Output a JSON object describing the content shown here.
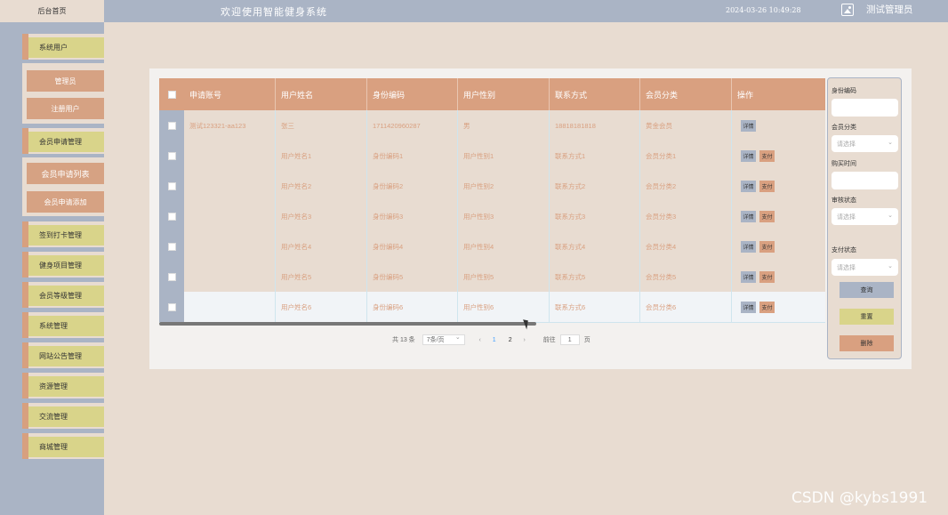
{
  "header": {
    "home_tab": "后台首页",
    "app_title": "欢迎使用智能健身系统",
    "datetime": "2024-03-26 10:49:28",
    "user_name": "测试管理员"
  },
  "sidebar": {
    "menu": [
      {
        "label": "系统用户"
      },
      {
        "label": "会员申请管理"
      },
      {
        "label": "签到打卡管理"
      },
      {
        "label": "健身项目管理"
      },
      {
        "label": "会员等级管理"
      },
      {
        "label": "系统管理"
      },
      {
        "label": "网站公告管理"
      },
      {
        "label": "资源管理"
      },
      {
        "label": "交流管理"
      },
      {
        "label": "商城管理"
      }
    ],
    "submenu_users": [
      {
        "label": "管理员"
      },
      {
        "label": "注册用户"
      }
    ],
    "submenu_apply": [
      {
        "label": "会员申请列表"
      },
      {
        "label": "会员申请添加"
      }
    ]
  },
  "table": {
    "headers": [
      "申请账号",
      "用户姓名",
      "身份编码",
      "用户性别",
      "联系方式",
      "会员分类",
      "操作"
    ],
    "rows": [
      [
        "测试123321-aa123",
        "张三",
        "1711420960287",
        "男",
        "18818181818",
        "黄金会员"
      ],
      [
        "",
        "用户姓名1",
        "身份编码1",
        "用户性别1",
        "联系方式1",
        "会员分类1"
      ],
      [
        "",
        "用户姓名2",
        "身份编码2",
        "用户性别2",
        "联系方式2",
        "会员分类2"
      ],
      [
        "",
        "用户姓名3",
        "身份编码3",
        "用户性别3",
        "联系方式3",
        "会员分类3"
      ],
      [
        "",
        "用户姓名4",
        "身份编码4",
        "用户性别4",
        "联系方式4",
        "会员分类4"
      ],
      [
        "",
        "用户姓名5",
        "身份编码5",
        "用户性别5",
        "联系方式5",
        "会员分类5"
      ],
      [
        "",
        "用户姓名6",
        "身份编码6",
        "用户性别6",
        "联系方式6",
        "会员分类6"
      ]
    ],
    "btn_detail": "详情",
    "btn_pay": "支付"
  },
  "pager": {
    "total": "共 13 条",
    "page_size": "7条/页",
    "pages": [
      "1",
      "2"
    ],
    "goto_label": "前往",
    "goto_value": "1",
    "page_suffix": "页"
  },
  "search": {
    "id_code_label": "身份编码",
    "member_type_label": "会员分类",
    "member_type_placeholder": "请选择",
    "buy_time_label": "购买时间",
    "review_status_label": "审核状态",
    "review_status_placeholder": "请选择",
    "pay_status_label": "支付状态",
    "pay_status_placeholder": "请选择",
    "query_button": "查询",
    "reset_button": "重置",
    "delete_button": "删除"
  },
  "watermark": "CSDN @kybs1991",
  "colors": {
    "accent": "#d9a080",
    "sidebar": "#aab4c5",
    "background": "#e8dcd1",
    "menu": "#d9d48a"
  }
}
